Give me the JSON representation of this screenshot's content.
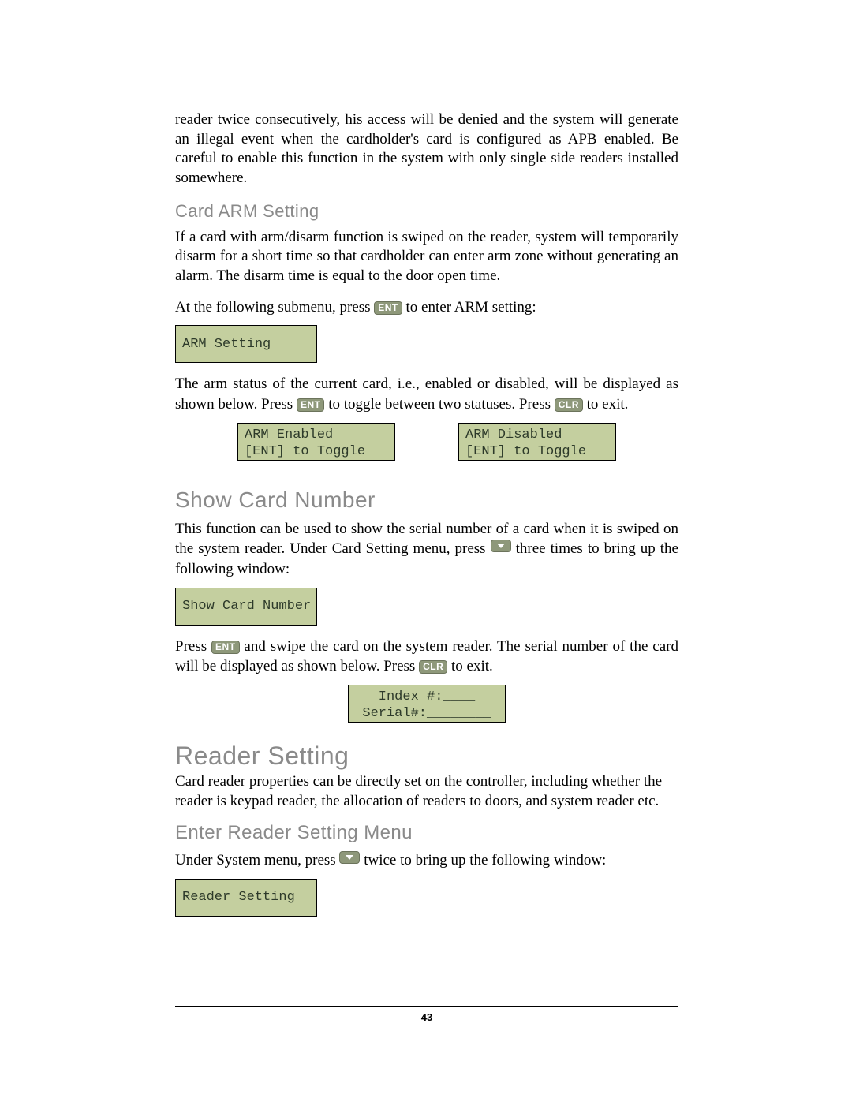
{
  "intro_paragraph": "reader twice consecutively, his access will be denied and the system will generate an illegal event when the cardholder's card is configured as APB enabled. Be careful to enable this function in the system with only single side readers installed somewhere.",
  "sec1": {
    "heading": "Card ARM Setting",
    "p1": "If a card with arm/disarm function is swiped on the reader, system will temporarily disarm for a short time so that cardholder can enter arm zone without generating an alarm. The disarm time is equal to the door open time.",
    "p2_a": "At the following submenu, press ",
    "p2_b": " to enter ARM setting:",
    "lcd1": "ARM Setting",
    "p3_a": "The arm status of the current card, i.e., enabled or disabled, will be displayed as shown below. Press ",
    "p3_b": " to toggle between two statuses. Press ",
    "p3_c": " to exit.",
    "lcd_left": "ARM Enabled\n[ENT] to Toggle",
    "lcd_right": "ARM Disabled\n[ENT] to Toggle"
  },
  "sec2": {
    "heading": "Show Card Number",
    "p1_a": "This function can be used to show the serial number of a card when it is swiped on the system reader. Under Card Setting menu, press ",
    "p1_b": " three times to bring up the following window:",
    "lcd1": "Show Card Number",
    "p2_a": "Press ",
    "p2_b": " and swipe the card on the system reader. The serial number of the card will be displayed as shown below. Press ",
    "p2_c": " to exit.",
    "lcd2": "Index #:____\nSerial#:________"
  },
  "sec3": {
    "heading": "Reader Setting",
    "p1": "Card reader properties can be directly set on the controller, including whether the reader is keypad reader, the allocation of readers to doors, and system reader etc.",
    "sub_heading": "Enter Reader Setting Menu",
    "p2_a": "Under System menu, press ",
    "p2_b": " twice to bring up the following window:",
    "lcd1": "Reader Setting"
  },
  "keys": {
    "ent": "ENT",
    "clr": "CLR"
  },
  "page_number": "43"
}
